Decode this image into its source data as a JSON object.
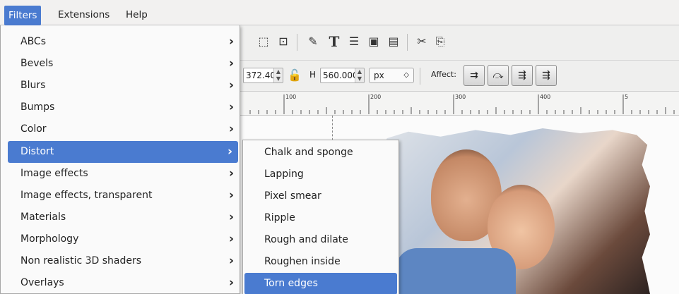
{
  "menubar": {
    "items": [
      {
        "label": "Filters"
      },
      {
        "label": "Extensions"
      },
      {
        "label": "Help"
      }
    ]
  },
  "filters_menu": {
    "items": [
      {
        "label": "ABCs"
      },
      {
        "label": "Bevels"
      },
      {
        "label": "Blurs"
      },
      {
        "label": "Bumps"
      },
      {
        "label": "Color"
      },
      {
        "label": "Distort"
      },
      {
        "label": "Image effects"
      },
      {
        "label": "Image effects, transparent"
      },
      {
        "label": "Materials"
      },
      {
        "label": "Morphology"
      },
      {
        "label": "Non realistic 3D shaders"
      },
      {
        "label": "Overlays"
      }
    ],
    "highlighted": "Distort"
  },
  "distort_submenu": {
    "items": [
      {
        "label": "Chalk and sponge"
      },
      {
        "label": "Lapping"
      },
      {
        "label": "Pixel smear"
      },
      {
        "label": "Ripple"
      },
      {
        "label": "Rough and dilate"
      },
      {
        "label": "Roughen inside"
      },
      {
        "label": "Torn edges"
      }
    ],
    "highlighted": "Torn edges"
  },
  "toolbar": {
    "width_value": "372.400",
    "h_label": "H",
    "height_value": "560.000",
    "unit": "px",
    "affect_label": "Affect:"
  },
  "ruler": {
    "labels": [
      "100",
      "200",
      "300",
      "400",
      "5"
    ]
  },
  "colors": {
    "highlight": "#4a7bd0",
    "menu_bg": "#fafafa"
  }
}
